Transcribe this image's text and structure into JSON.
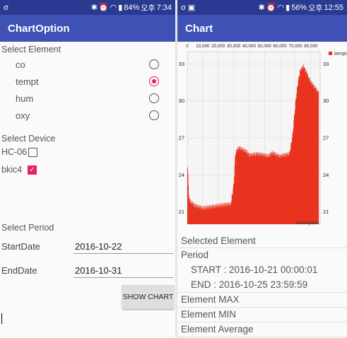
{
  "left_screen": {
    "status": {
      "carrier": "σ",
      "battery": "84%",
      "ampm": "오후",
      "time": "7:34"
    },
    "app_title": "ChartOption",
    "select_element": {
      "title": "Select Element",
      "options": [
        {
          "label": "co",
          "selected": false
        },
        {
          "label": "tempt",
          "selected": true
        },
        {
          "label": "hum",
          "selected": false
        },
        {
          "label": "oxy",
          "selected": false
        }
      ]
    },
    "select_device": {
      "title": "Select Device",
      "devices": [
        {
          "label": "HC-06",
          "checked": false
        },
        {
          "label": "bkic4",
          "checked": true
        }
      ]
    },
    "select_period": {
      "title": "Select Period",
      "start_label": "StartDate",
      "start_value": "2016-10-22",
      "end_label": "EndDate",
      "end_value": "2016-10-31"
    },
    "show_chart_button": "SHOW CHART"
  },
  "right_screen": {
    "status": {
      "carrier": "σ",
      "battery": "56%",
      "ampm": "오후",
      "time": "12:55"
    },
    "app_title": "Chart",
    "chart_data": {
      "type": "bar",
      "x_ticks": [
        "0",
        "10,000",
        "20,000",
        "30,000",
        "40,000",
        "50,000",
        "60,000",
        "70,000",
        "80,000"
      ],
      "y_ticks": [
        "21",
        "24",
        "27",
        "30",
        "33"
      ],
      "ylim": [
        20,
        34
      ],
      "xlim": [
        0,
        86000
      ],
      "legend": "tempt",
      "legend_position": "top-right",
      "description": "Description",
      "grid": true,
      "color": "#e8321e",
      "series": [
        {
          "name": "tempt",
          "x": [
            0,
            1000,
            2000,
            5000,
            10000,
            15000,
            20000,
            25000,
            28000,
            30000,
            31000,
            33000,
            35000,
            38000,
            40000,
            45000,
            50000,
            52000,
            55000,
            58000,
            60000,
            62000,
            66000,
            68000,
            70000,
            71500,
            73000,
            75000,
            77000,
            79000,
            81000,
            83000,
            85000
          ],
          "values": [
            24.6,
            22.0,
            21.8,
            21.5,
            21.3,
            21.4,
            21.5,
            21.6,
            21.6,
            23.3,
            25.8,
            26.2,
            26.1,
            25.9,
            25.6,
            25.7,
            25.6,
            25.5,
            25.8,
            25.6,
            25.5,
            25.6,
            25.7,
            27.2,
            30.0,
            31.5,
            32.5,
            32.8,
            32.3,
            31.7,
            31.3,
            31.0,
            30.6
          ]
        }
      ]
    },
    "info": {
      "selected_element": "Selected Element",
      "period": "Period",
      "start": "START : 2016-10-21 00:00:01",
      "end": "END : 2016-10-25 23:59:59",
      "max": "Element MAX",
      "min": "Element MIN",
      "average": "Element Average"
    }
  }
}
